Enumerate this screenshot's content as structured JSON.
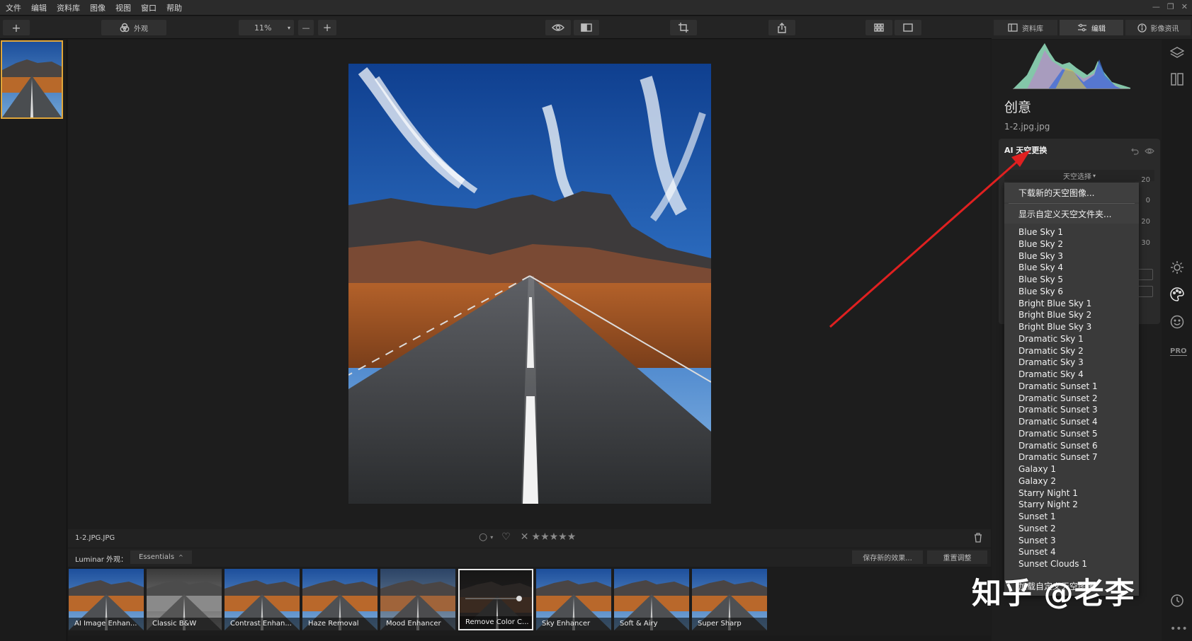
{
  "menubar": {
    "items": [
      "文件",
      "编辑",
      "资料库",
      "图像",
      "视图",
      "窗口",
      "帮助"
    ],
    "window_controls": [
      "—",
      "❐",
      "✕"
    ]
  },
  "toolbar": {
    "add_label": "+",
    "looks_label": "外观",
    "zoom_value": "11%",
    "zoom_out": "—",
    "zoom_in": "+"
  },
  "right_tabs": {
    "library": "资料库",
    "edit": "编辑",
    "info": "影像资讯"
  },
  "panel": {
    "title": "创意",
    "filename": "1-2.jpg.jpg",
    "sky": {
      "header": "AI 天空更换",
      "select_label": "天空选择",
      "values": [
        "20",
        "0",
        "20",
        "30"
      ]
    }
  },
  "dropdown": {
    "actions": [
      "下载新的天空图像...",
      "显示自定义天空文件夹..."
    ],
    "items": [
      "Blue Sky 1",
      "Blue Sky 2",
      "Blue Sky 3",
      "Blue Sky 4",
      "Blue Sky 5",
      "Blue Sky 6",
      "Bright Blue Sky 1",
      "Bright Blue Sky 2",
      "Bright Blue Sky 3",
      "Dramatic Sky 1",
      "Dramatic Sky 2",
      "Dramatic Sky 3",
      "Dramatic Sky 4",
      "Dramatic Sunset 1",
      "Dramatic Sunset 2",
      "Dramatic Sunset 3",
      "Dramatic Sunset 4",
      "Dramatic Sunset 5",
      "Dramatic Sunset 6",
      "Dramatic Sunset 7",
      "Galaxy 1",
      "Galaxy 2",
      "Starry Night 1",
      "Starry Night 2",
      "Sunset 1",
      "Sunset 2",
      "Sunset 3",
      "Sunset 4",
      "Sunset Clouds 1"
    ],
    "bottom_action": "加载自定义天空图像..."
  },
  "infobar": {
    "filename": "1-2.JPG.JPG",
    "stars": "★★★★★"
  },
  "lookbar": {
    "label": "Luminar 外观：",
    "collection": "Essentials",
    "save_effect": "保存新的效果...",
    "reset_adjust": "重置调整"
  },
  "presets": [
    {
      "label": "AI Image Enhan...",
      "style": "color"
    },
    {
      "label": "Classic B&W",
      "style": "bw"
    },
    {
      "label": "Contrast Enhan...",
      "style": "color"
    },
    {
      "label": "Haze Removal",
      "style": "color"
    },
    {
      "label": "Mood Enhancer",
      "style": "muted"
    },
    {
      "label": "Remove Color C...",
      "style": "dark"
    },
    {
      "label": "Sky Enhancer",
      "style": "color"
    },
    {
      "label": "Soft & Airy",
      "style": "color"
    },
    {
      "label": "Super Sharp",
      "style": "color"
    }
  ],
  "watermark": "知乎 @老李",
  "colors": {
    "accent_thumb_border": "#e0a63a",
    "arrow": "#e02020"
  }
}
